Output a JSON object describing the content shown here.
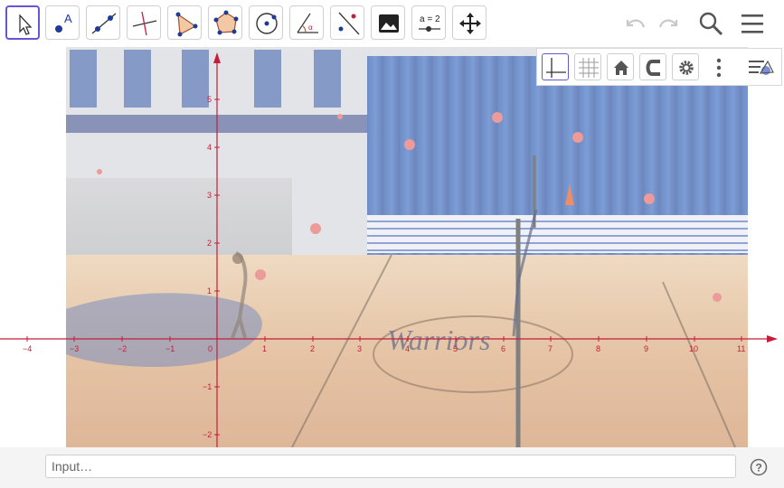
{
  "toolbar": {
    "tools": [
      {
        "name": "Move",
        "icon": "move-arrow-icon"
      },
      {
        "name": "Point",
        "icon": "point-icon"
      },
      {
        "name": "Line",
        "icon": "line-icon"
      },
      {
        "name": "Perpendicular Line",
        "icon": "perpendicular-icon"
      },
      {
        "name": "Polygon",
        "icon": "polygon-icon"
      },
      {
        "name": "Circle with Center through Point",
        "icon": "circle-icon"
      },
      {
        "name": "Circle",
        "icon": "circle-center-icon"
      },
      {
        "name": "Angle",
        "icon": "angle-icon"
      },
      {
        "name": "Reflect about Line",
        "icon": "reflect-icon"
      },
      {
        "name": "Image",
        "icon": "image-icon"
      },
      {
        "name": "Slider",
        "icon": "slider-icon",
        "label": "a = 2"
      },
      {
        "name": "Move Graphics View",
        "icon": "move-view-icon"
      }
    ],
    "active_tool": "Move",
    "undo_icon": "undo-icon",
    "redo_icon": "redo-icon",
    "search_icon": "search-icon",
    "menu_icon": "menu-icon",
    "point_label": "A"
  },
  "graphics": {
    "x_ticks": [
      "−4",
      "−3",
      "−2",
      "−1",
      "0",
      "1",
      "2",
      "3",
      "4",
      "5",
      "6",
      "7",
      "8",
      "9",
      "10",
      "11"
    ],
    "y_ticks": [
      "5",
      "4",
      "3",
      "2",
      "1",
      "−1",
      "−2"
    ],
    "axis_color": "#c41e3a",
    "background_image": "gym-volleyball-photo",
    "floor_text": "Warriors"
  },
  "stylebar": {
    "buttons": [
      {
        "name": "Show Axes",
        "icon": "axes-icon",
        "active": true
      },
      {
        "name": "Show Grid",
        "icon": "grid-icon",
        "active": false
      },
      {
        "name": "Standard View",
        "icon": "home-icon",
        "active": false
      },
      {
        "name": "Point Capturing",
        "icon": "magnet-icon",
        "active": false
      },
      {
        "name": "Settings",
        "icon": "gear-icon",
        "active": false
      },
      {
        "name": "More",
        "icon": "more-vertical-icon",
        "active": false
      },
      {
        "name": "Toggle Style Bar",
        "icon": "style-bar-toggle-icon",
        "active": false
      }
    ]
  },
  "input": {
    "placeholder": "Input…",
    "help_icon": "help-icon",
    "help_glyph": "?"
  }
}
